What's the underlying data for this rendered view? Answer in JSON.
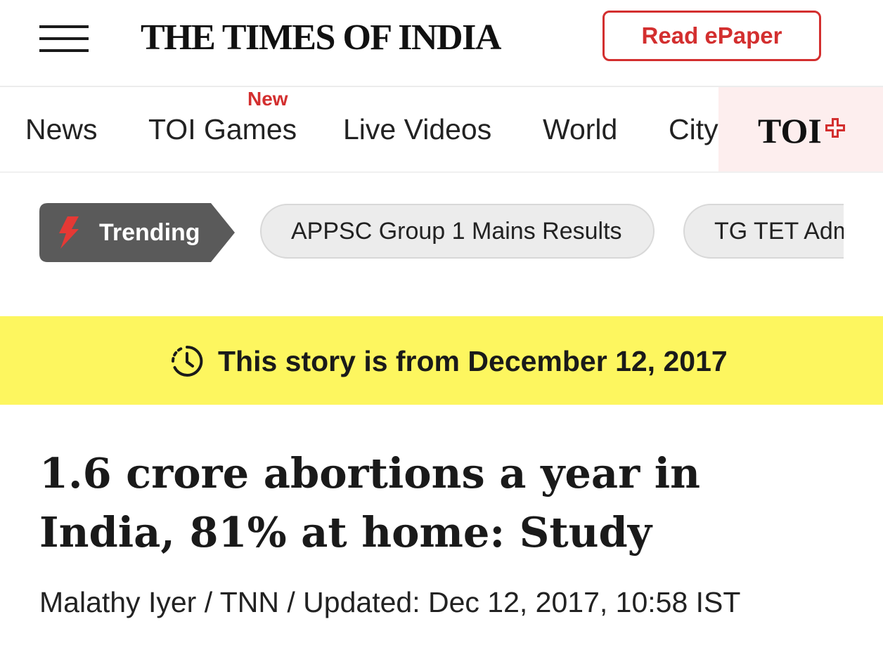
{
  "header": {
    "logo_text": "THE TIMES OF INDIA",
    "epaper_label": "Read ePaper",
    "menu_icon": "hamburger-menu-icon"
  },
  "nav": {
    "items": [
      {
        "label": "News"
      },
      {
        "label": "TOI Games",
        "badge": "New"
      },
      {
        "label": "Live Videos"
      },
      {
        "label": "World"
      },
      {
        "label": "City"
      }
    ],
    "toi_plus_label": "TOI",
    "toi_plus_icon": "plus-icon"
  },
  "trending": {
    "label": "Trending",
    "icon": "lightning-bolt-icon",
    "chips": [
      {
        "label": "APPSC Group 1 Mains Results"
      },
      {
        "label": "TG TET Adm"
      }
    ]
  },
  "banner": {
    "icon": "history-clock-icon",
    "text": "This story is from December 12, 2017"
  },
  "article": {
    "headline": "1.6 crore abortions a year in India, 81% at home: Study",
    "author": "Malathy Iyer",
    "byline_rest": " / TNN / Updated: Dec 12, 2017, 10:58 IST"
  },
  "colors": {
    "accent_red": "#d32f2f",
    "banner_yellow": "#fdf65f",
    "trending_bg": "#5a5a5a",
    "toi_plus_bg": "#fdeeee"
  }
}
